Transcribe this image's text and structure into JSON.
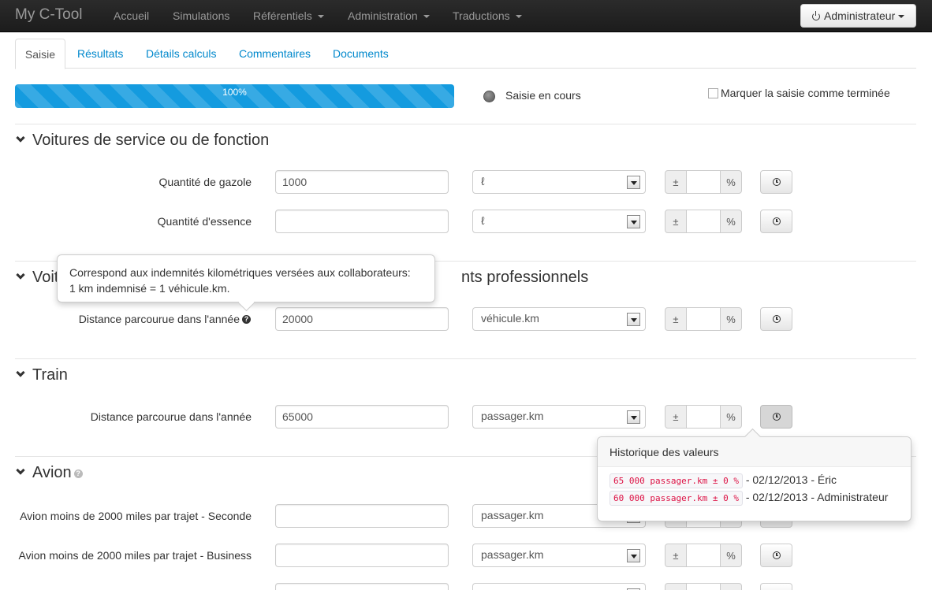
{
  "navbar": {
    "brand": "My C-Tool",
    "items": [
      {
        "label": "Accueil"
      },
      {
        "label": "Simulations"
      },
      {
        "label": "Référentiels"
      },
      {
        "label": "Administration"
      },
      {
        "label": "Traductions"
      }
    ],
    "user_button": "Administrateur"
  },
  "tabs": [
    {
      "label": "Saisie",
      "active": true
    },
    {
      "label": "Résultats"
    },
    {
      "label": "Détails calculs"
    },
    {
      "label": "Commentaires"
    },
    {
      "label": "Documents"
    }
  ],
  "progress": {
    "percent": 100,
    "label": "100%"
  },
  "status": {
    "text": "Saisie en cours"
  },
  "mark_complete": {
    "label": "Marquer la saisie comme terminée",
    "checked": false
  },
  "sections": {
    "voitures": {
      "title": "Voitures de service ou de fonction",
      "rows": [
        {
          "label": "Quantité de gazole",
          "value": "1000",
          "unit": "ℓ"
        },
        {
          "label": "Quantité d'essence",
          "value": "",
          "unit": "ℓ"
        }
      ]
    },
    "voitures_perso": {
      "title_start": "Voit",
      "title_end": "nts professionnels",
      "rows": [
        {
          "label": "Distance parcourue dans l'année",
          "value": "20000",
          "unit": "véhicule.km"
        }
      ]
    },
    "train": {
      "title": "Train",
      "rows": [
        {
          "label": "Distance parcourue dans l'année",
          "value": "65000",
          "unit": "passager.km"
        }
      ]
    },
    "avion": {
      "title": "Avion",
      "rows": [
        {
          "label": "Avion moins de 2000 miles par trajet - Seconde",
          "value": "",
          "unit": "passager.km"
        },
        {
          "label": "Avion moins de 2000 miles par trajet - Business",
          "value": "",
          "unit": "passager.km"
        }
      ]
    }
  },
  "uncertainty": {
    "plus_minus": "±",
    "percent": "%"
  },
  "tooltip": {
    "line1": "Correspond aux indemnités kilométriques versées aux collaborateurs:",
    "line2": "1 km indemnisé = 1 véhicule.km."
  },
  "history_popover": {
    "title": "Historique des valeurs",
    "entries": [
      {
        "value": "65 000 passager.km ± 0 %",
        "meta": " - 02/12/2013 - Éric"
      },
      {
        "value": "60 000 passager.km ± 0 %",
        "meta": " - 02/12/2013 - Administrateur"
      }
    ]
  },
  "help_mark": "?"
}
